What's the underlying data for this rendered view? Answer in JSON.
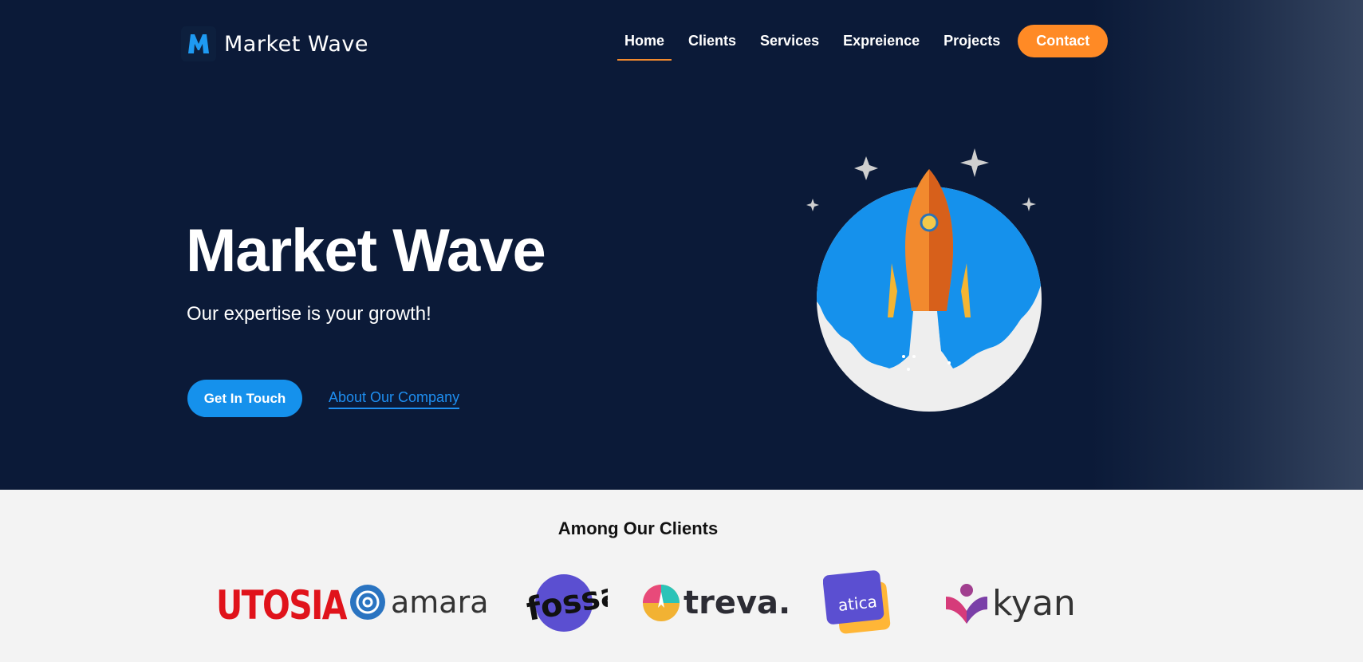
{
  "brand": {
    "name": "Market Wave",
    "logo_icon": "m-logo-icon",
    "accent": "#ff8a25",
    "primary": "#1591ec"
  },
  "nav": {
    "items": [
      {
        "label": "Home",
        "active": true
      },
      {
        "label": "Clients"
      },
      {
        "label": "Services"
      },
      {
        "label": "Expreience"
      },
      {
        "label": "Projects"
      }
    ],
    "contact_label": "Contact"
  },
  "hero": {
    "title": "Market Wave",
    "subtitle": "Our expertise is your growth!",
    "cta_primary": "Get In Touch",
    "cta_secondary": "About Our Company",
    "illustration": "rocket-icon"
  },
  "clients": {
    "title": "Among Our Clients",
    "logos": [
      "UTOSIA",
      "amara",
      "fossa",
      "treva.",
      "atica",
      "kyan"
    ]
  }
}
